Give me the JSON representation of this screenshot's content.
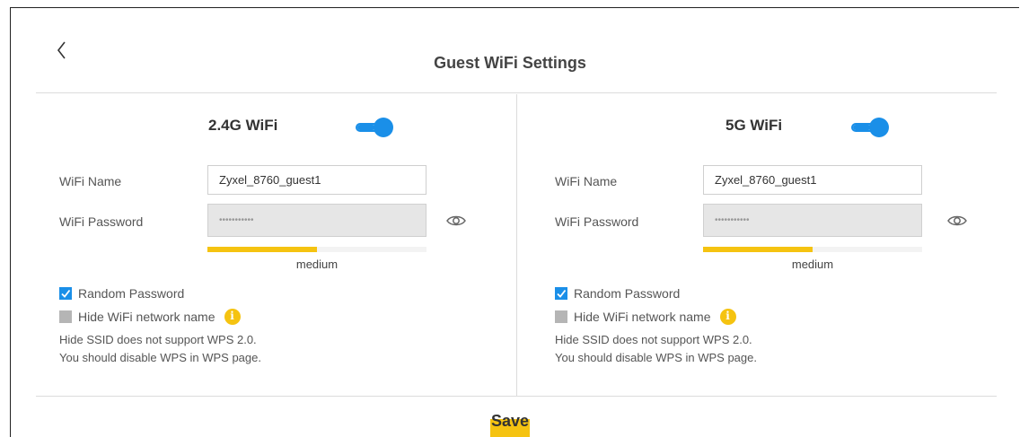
{
  "page": {
    "title": "Guest WiFi Settings"
  },
  "bands": [
    {
      "title": "2.4G WiFi",
      "enabled": true,
      "wifi_name_label": "WiFi Name",
      "wifi_name_value": "Zyxel_8760_guest1",
      "wifi_password_label": "WiFi Password",
      "wifi_password_value": "•••••••••••",
      "strength_level": 0.5,
      "strength_label": "medium",
      "random_password_label": "Random Password",
      "random_password_checked": true,
      "hide_network_label": "Hide WiFi network name",
      "hide_network_checked": false,
      "note_line1": "Hide SSID does not support WPS 2.0.",
      "note_line2": "You should disable WPS in WPS page."
    },
    {
      "title": "5G WiFi",
      "enabled": true,
      "wifi_name_label": "WiFi Name",
      "wifi_name_value": "Zyxel_8760_guest1",
      "wifi_password_label": "WiFi Password",
      "wifi_password_value": "•••••••••••",
      "strength_level": 0.5,
      "strength_label": "medium",
      "random_password_label": "Random Password",
      "random_password_checked": true,
      "hide_network_label": "Hide WiFi network name",
      "hide_network_checked": false,
      "note_line1": "Hide SSID does not support WPS 2.0.",
      "note_line2": "You should disable WPS in WPS page."
    }
  ],
  "actions": {
    "save_label": "Save"
  },
  "icons": {
    "back": "chevron-left-icon",
    "eye": "eye-icon",
    "info": "info-icon",
    "check": "check-icon"
  },
  "colors": {
    "accent": "#1a8fe8",
    "highlight": "#f5c311",
    "input_disabled": "#e6e6e6"
  }
}
